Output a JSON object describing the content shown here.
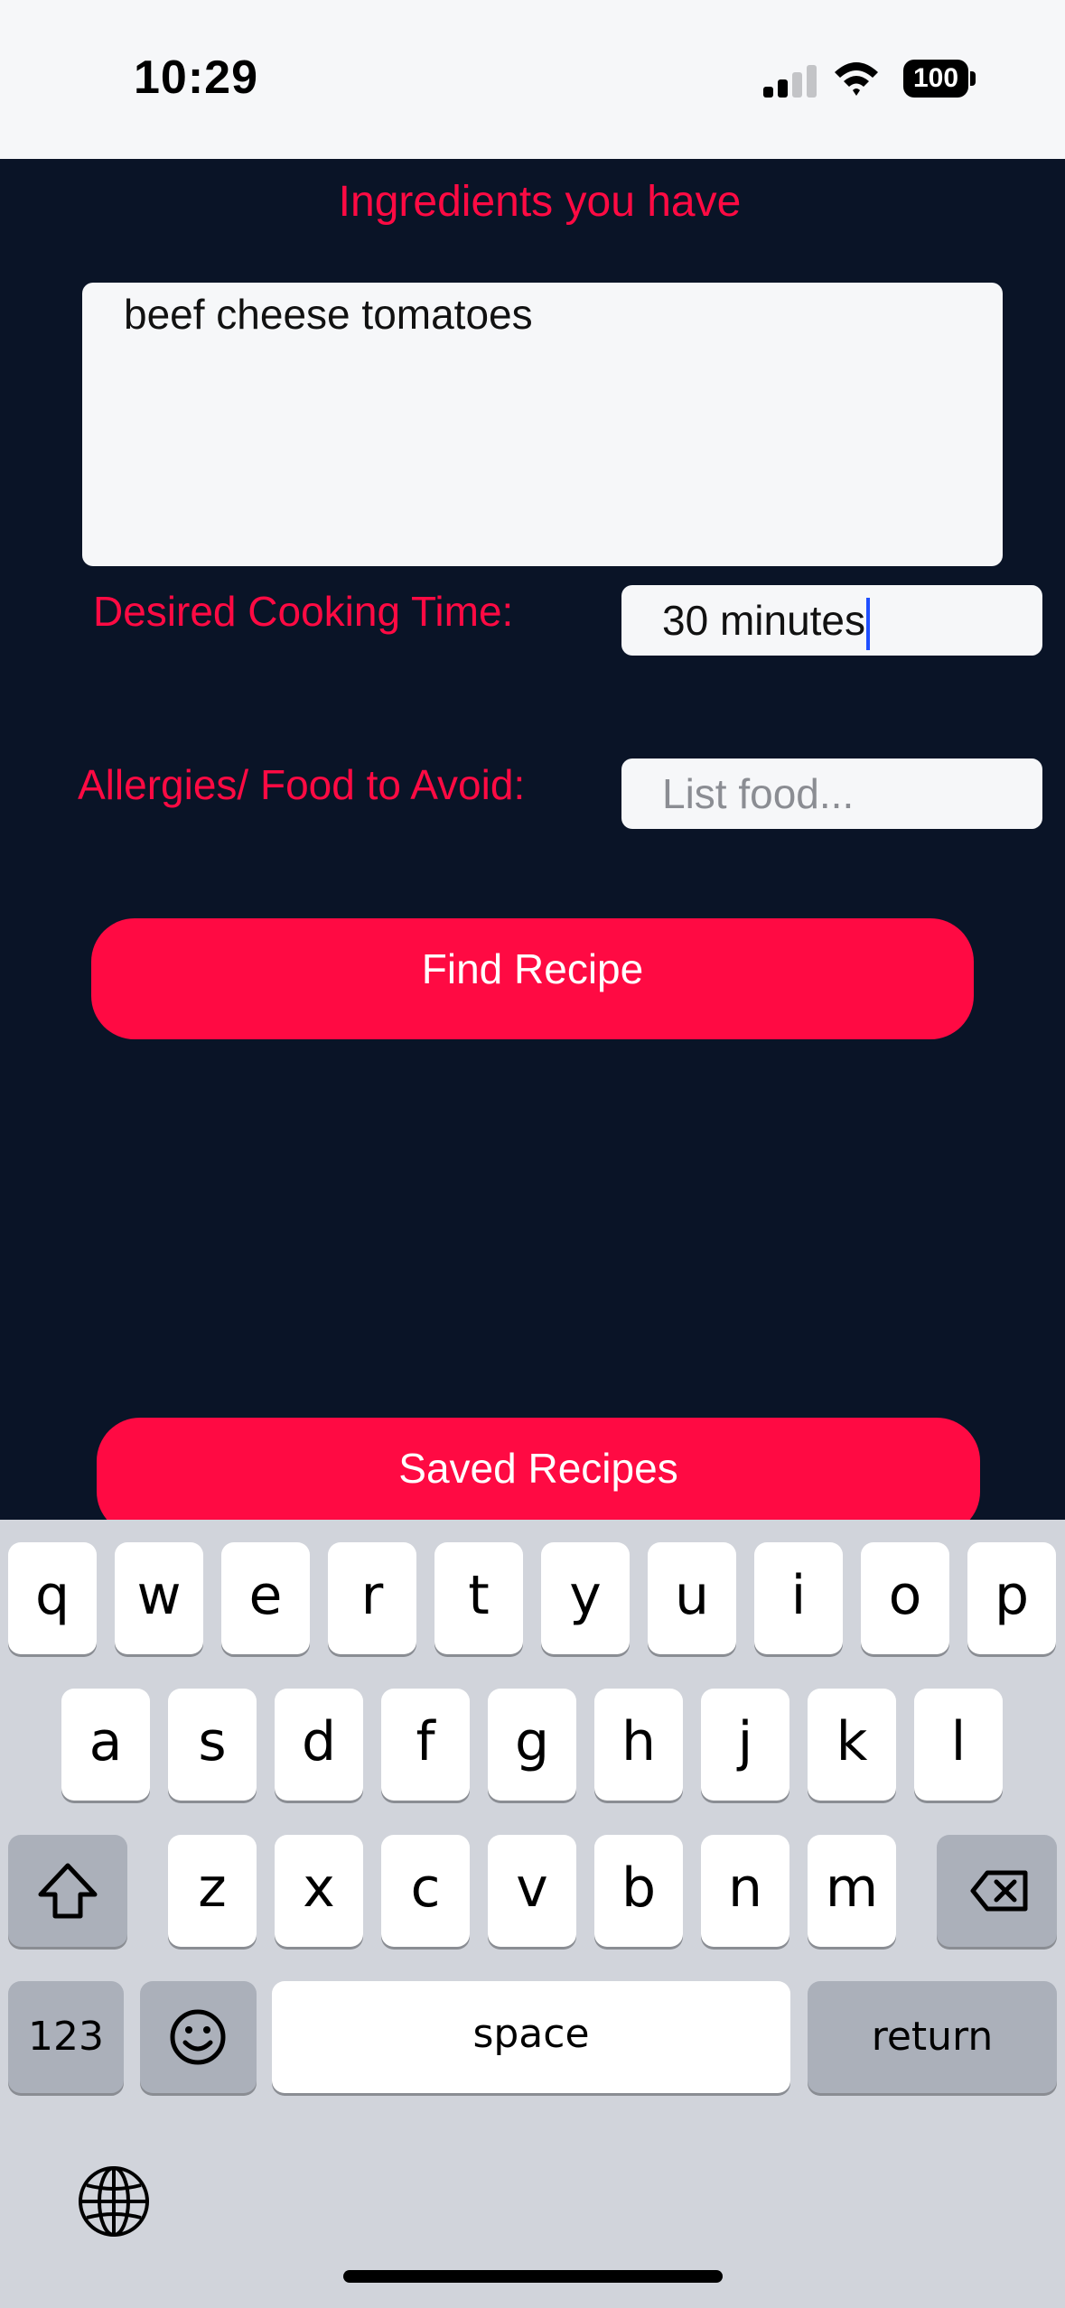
{
  "status_bar": {
    "time": "10:29",
    "battery_level": "100",
    "icons": [
      "cellular-signal-icon",
      "wifi-icon",
      "battery-icon"
    ]
  },
  "colors": {
    "background": "#0a1427",
    "accent": "#ff0a43",
    "field_background": "#f6f7f9",
    "keyboard_background": "#d1d4db"
  },
  "form": {
    "heading": "Ingredients you have",
    "ingredients_value": "beef cheese tomatoes",
    "cooking_time_label": "Desired Cooking Time:",
    "cooking_time_value": "30 minutes",
    "allergies_label": "Allergies/ Food to Avoid:",
    "allergies_placeholder": "List food...",
    "find_button": "Find Recipe",
    "saved_button": "Saved Recipes"
  },
  "keyboard": {
    "row1": [
      "q",
      "w",
      "e",
      "r",
      "t",
      "y",
      "u",
      "i",
      "o",
      "p"
    ],
    "row2": [
      "a",
      "s",
      "d",
      "f",
      "g",
      "h",
      "j",
      "k",
      "l"
    ],
    "row3": [
      "z",
      "x",
      "c",
      "v",
      "b",
      "n",
      "m"
    ],
    "numbers_key": "123",
    "space_key": "space",
    "return_key": "return",
    "icons": [
      "shift-icon",
      "backspace-icon",
      "emoji-icon",
      "globe-icon"
    ]
  }
}
